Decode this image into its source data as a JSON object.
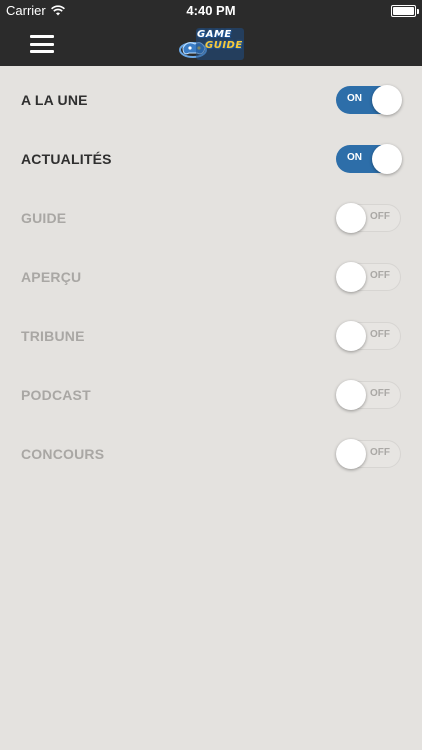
{
  "status_bar": {
    "carrier": "Carrier",
    "time": "4:40 PM",
    "wifi_icon": "wifi-icon",
    "battery_icon": "battery-icon"
  },
  "nav_bar": {
    "menu_icon": "hamburger-menu-icon",
    "logo_line1": "GAME",
    "logo_line2": "GUIDE"
  },
  "settings": [
    {
      "label": "A LA UNE",
      "state": "ON",
      "enabled": true
    },
    {
      "label": "ACTUALITÉS",
      "state": "ON",
      "enabled": true
    },
    {
      "label": "GUIDE",
      "state": "OFF",
      "enabled": false
    },
    {
      "label": "APERÇU",
      "state": "OFF",
      "enabled": false
    },
    {
      "label": "TRIBUNE",
      "state": "OFF",
      "enabled": false
    },
    {
      "label": "PODCAST",
      "state": "OFF",
      "enabled": false
    },
    {
      "label": "CONCOURS",
      "state": "OFF",
      "enabled": false
    }
  ],
  "colors": {
    "nav_background": "#2b2b2b",
    "page_background": "#e4e2df",
    "toggle_on": "#2d6ea9",
    "label_active": "#2f2f2f",
    "label_inactive": "#a9a7a4"
  }
}
